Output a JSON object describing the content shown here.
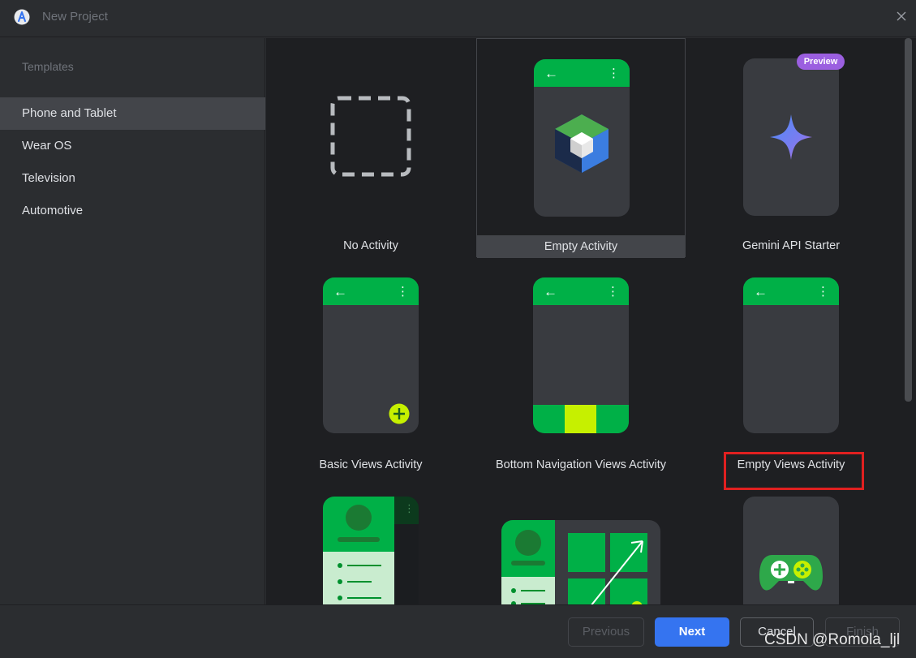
{
  "window": {
    "title": "New Project"
  },
  "sidebar": {
    "header": "Templates",
    "items": [
      {
        "label": "Phone and Tablet",
        "selected": true
      },
      {
        "label": "Wear OS",
        "selected": false
      },
      {
        "label": "Television",
        "selected": false
      },
      {
        "label": "Automotive",
        "selected": false
      }
    ]
  },
  "templates": [
    {
      "label": "No Activity",
      "icon": "dashed-square-icon"
    },
    {
      "label": "Empty Activity",
      "icon": "compose-cube-icon",
      "selected": true
    },
    {
      "label": "Gemini API Starter",
      "icon": "gemini-sparkle-icon",
      "badge": "Preview"
    },
    {
      "label": "Basic Views Activity",
      "icon": "fab-plus-icon"
    },
    {
      "label": "Bottom Navigation Views Activity",
      "icon": "bottom-nav-icon"
    },
    {
      "label": "Empty Views Activity",
      "icon": "empty-phone-icon",
      "highlighted": true
    },
    {
      "label": "",
      "icon": "navigation-drawer-icon"
    },
    {
      "label": "",
      "icon": "responsive-layout-icon"
    },
    {
      "label": "",
      "icon": "gamepad-icon"
    }
  ],
  "footer": {
    "previous": "Previous",
    "next": "Next",
    "cancel": "Cancel",
    "finish": "Finish"
  },
  "watermark": "CSDN @Romola_ljl",
  "colors": {
    "accent": "#3574f0",
    "android_green": "#00b047",
    "preview_badge": "#9b5fe0",
    "highlight": "#e02020"
  }
}
